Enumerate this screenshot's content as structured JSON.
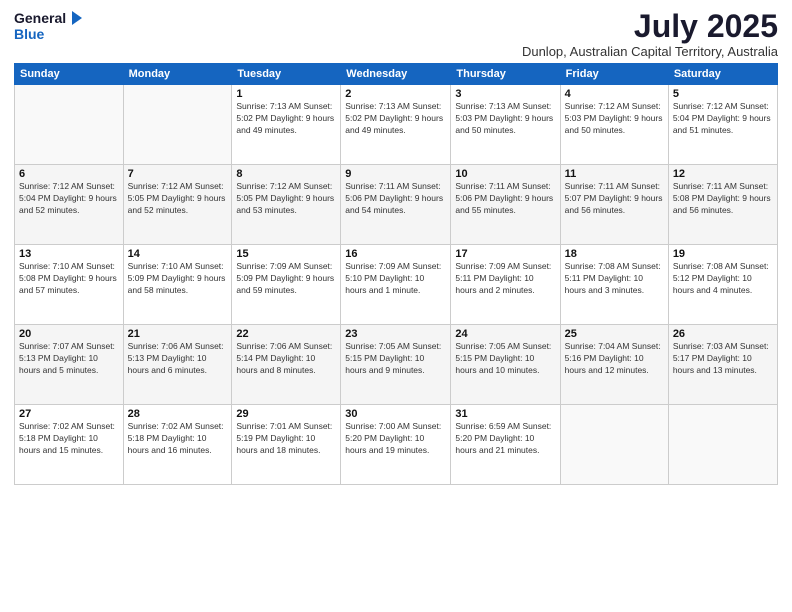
{
  "header": {
    "logo_line1": "General",
    "logo_line2": "Blue",
    "month": "July 2025",
    "location": "Dunlop, Australian Capital Territory, Australia"
  },
  "weekdays": [
    "Sunday",
    "Monday",
    "Tuesday",
    "Wednesday",
    "Thursday",
    "Friday",
    "Saturday"
  ],
  "weeks": [
    [
      {
        "day": "",
        "info": ""
      },
      {
        "day": "",
        "info": ""
      },
      {
        "day": "1",
        "info": "Sunrise: 7:13 AM\nSunset: 5:02 PM\nDaylight: 9 hours\nand 49 minutes."
      },
      {
        "day": "2",
        "info": "Sunrise: 7:13 AM\nSunset: 5:02 PM\nDaylight: 9 hours\nand 49 minutes."
      },
      {
        "day": "3",
        "info": "Sunrise: 7:13 AM\nSunset: 5:03 PM\nDaylight: 9 hours\nand 50 minutes."
      },
      {
        "day": "4",
        "info": "Sunrise: 7:12 AM\nSunset: 5:03 PM\nDaylight: 9 hours\nand 50 minutes."
      },
      {
        "day": "5",
        "info": "Sunrise: 7:12 AM\nSunset: 5:04 PM\nDaylight: 9 hours\nand 51 minutes."
      }
    ],
    [
      {
        "day": "6",
        "info": "Sunrise: 7:12 AM\nSunset: 5:04 PM\nDaylight: 9 hours\nand 52 minutes."
      },
      {
        "day": "7",
        "info": "Sunrise: 7:12 AM\nSunset: 5:05 PM\nDaylight: 9 hours\nand 52 minutes."
      },
      {
        "day": "8",
        "info": "Sunrise: 7:12 AM\nSunset: 5:05 PM\nDaylight: 9 hours\nand 53 minutes."
      },
      {
        "day": "9",
        "info": "Sunrise: 7:11 AM\nSunset: 5:06 PM\nDaylight: 9 hours\nand 54 minutes."
      },
      {
        "day": "10",
        "info": "Sunrise: 7:11 AM\nSunset: 5:06 PM\nDaylight: 9 hours\nand 55 minutes."
      },
      {
        "day": "11",
        "info": "Sunrise: 7:11 AM\nSunset: 5:07 PM\nDaylight: 9 hours\nand 56 minutes."
      },
      {
        "day": "12",
        "info": "Sunrise: 7:11 AM\nSunset: 5:08 PM\nDaylight: 9 hours\nand 56 minutes."
      }
    ],
    [
      {
        "day": "13",
        "info": "Sunrise: 7:10 AM\nSunset: 5:08 PM\nDaylight: 9 hours\nand 57 minutes."
      },
      {
        "day": "14",
        "info": "Sunrise: 7:10 AM\nSunset: 5:09 PM\nDaylight: 9 hours\nand 58 minutes."
      },
      {
        "day": "15",
        "info": "Sunrise: 7:09 AM\nSunset: 5:09 PM\nDaylight: 9 hours\nand 59 minutes."
      },
      {
        "day": "16",
        "info": "Sunrise: 7:09 AM\nSunset: 5:10 PM\nDaylight: 10 hours\nand 1 minute."
      },
      {
        "day": "17",
        "info": "Sunrise: 7:09 AM\nSunset: 5:11 PM\nDaylight: 10 hours\nand 2 minutes."
      },
      {
        "day": "18",
        "info": "Sunrise: 7:08 AM\nSunset: 5:11 PM\nDaylight: 10 hours\nand 3 minutes."
      },
      {
        "day": "19",
        "info": "Sunrise: 7:08 AM\nSunset: 5:12 PM\nDaylight: 10 hours\nand 4 minutes."
      }
    ],
    [
      {
        "day": "20",
        "info": "Sunrise: 7:07 AM\nSunset: 5:13 PM\nDaylight: 10 hours\nand 5 minutes."
      },
      {
        "day": "21",
        "info": "Sunrise: 7:06 AM\nSunset: 5:13 PM\nDaylight: 10 hours\nand 6 minutes."
      },
      {
        "day": "22",
        "info": "Sunrise: 7:06 AM\nSunset: 5:14 PM\nDaylight: 10 hours\nand 8 minutes."
      },
      {
        "day": "23",
        "info": "Sunrise: 7:05 AM\nSunset: 5:15 PM\nDaylight: 10 hours\nand 9 minutes."
      },
      {
        "day": "24",
        "info": "Sunrise: 7:05 AM\nSunset: 5:15 PM\nDaylight: 10 hours\nand 10 minutes."
      },
      {
        "day": "25",
        "info": "Sunrise: 7:04 AM\nSunset: 5:16 PM\nDaylight: 10 hours\nand 12 minutes."
      },
      {
        "day": "26",
        "info": "Sunrise: 7:03 AM\nSunset: 5:17 PM\nDaylight: 10 hours\nand 13 minutes."
      }
    ],
    [
      {
        "day": "27",
        "info": "Sunrise: 7:02 AM\nSunset: 5:18 PM\nDaylight: 10 hours\nand 15 minutes."
      },
      {
        "day": "28",
        "info": "Sunrise: 7:02 AM\nSunset: 5:18 PM\nDaylight: 10 hours\nand 16 minutes."
      },
      {
        "day": "29",
        "info": "Sunrise: 7:01 AM\nSunset: 5:19 PM\nDaylight: 10 hours\nand 18 minutes."
      },
      {
        "day": "30",
        "info": "Sunrise: 7:00 AM\nSunset: 5:20 PM\nDaylight: 10 hours\nand 19 minutes."
      },
      {
        "day": "31",
        "info": "Sunrise: 6:59 AM\nSunset: 5:20 PM\nDaylight: 10 hours\nand 21 minutes."
      },
      {
        "day": "",
        "info": ""
      },
      {
        "day": "",
        "info": ""
      }
    ]
  ]
}
